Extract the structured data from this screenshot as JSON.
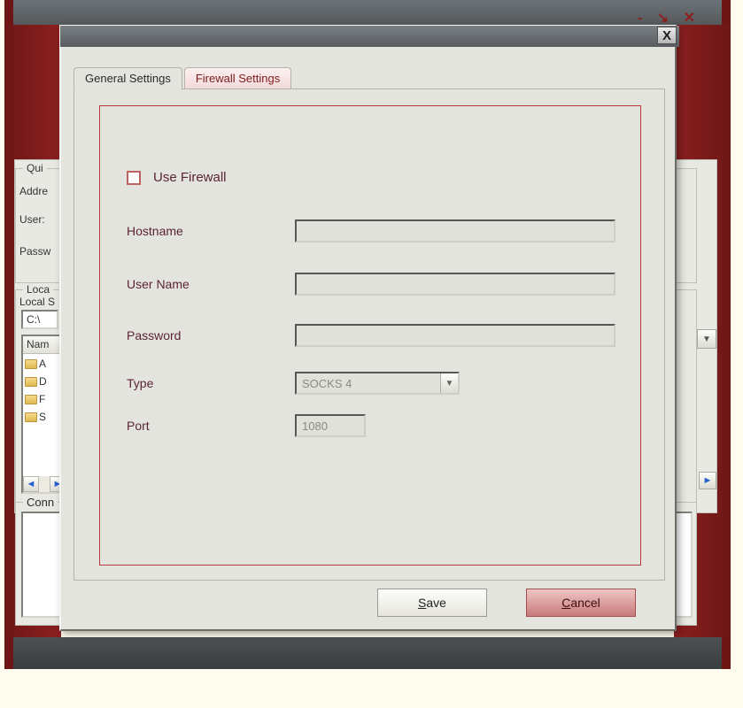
{
  "bg_window": {
    "title_icons": "-  ↘  ✕",
    "quick_group_label": "Qui",
    "quick_labels": {
      "address": "Addre",
      "user": "User:",
      "password": "Passw"
    },
    "local_group_label": "Loca",
    "local_system_label": "Local S",
    "path_value": "C:\\",
    "name_col": "Nam",
    "folders": [
      "A",
      "D",
      "F",
      "S"
    ],
    "conn_label": "Conn"
  },
  "dialog": {
    "tabs": {
      "general": "General Settings",
      "firewall": "Firewall Settings"
    },
    "use_firewall_label": "Use Firewall",
    "use_firewall_checked": false,
    "fields": {
      "hostname_label": "Hostname",
      "hostname_value": "",
      "username_label": "User Name",
      "username_value": "",
      "password_label": "Password",
      "password_value": "",
      "type_label": "Type",
      "type_value": "SOCKS 4",
      "port_label": "Port",
      "port_value": "1080"
    },
    "buttons": {
      "save_prefix": "S",
      "save_rest": "ave",
      "cancel_prefix": "C",
      "cancel_rest": "ancel"
    }
  }
}
